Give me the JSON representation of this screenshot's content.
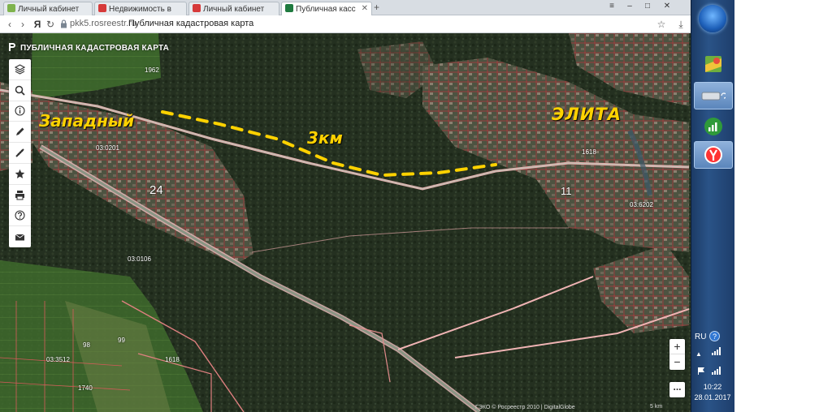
{
  "browser": {
    "tabs": [
      {
        "label": "Личный кабинет",
        "favicon_color": "#7fb34d"
      },
      {
        "label": "Недвижимость в",
        "favicon_color": "#d63a3a"
      },
      {
        "label": "Личный кабинет",
        "favicon_color": "#d63a3a"
      },
      {
        "label": "Публичная касс",
        "favicon_color": "#1f7a3f"
      }
    ],
    "url": "pkk5.rosreestr.ru",
    "page_title": "Публичная кадастровая карта"
  },
  "map": {
    "app_title": "ПУБЛИЧНАЯ КАДАСТРОВАЯ КАРТА",
    "toolbar_icons": [
      "layers-icon",
      "search-icon",
      "info-icon",
      "pencil-icon",
      "measure-icon",
      "star-icon",
      "print-icon",
      "help-icon",
      "mail-icon"
    ],
    "annotations": {
      "west_settlement": "Западный",
      "elita_settlement": "ЭЛИТА",
      "distance": "3км"
    },
    "plot_numbers": {
      "n24": "24",
      "n11": "11",
      "c1": "03:0201",
      "c2": "03:0106",
      "c3": "03:6202",
      "c4": "03:3512",
      "c5": "1618",
      "c6": "1618",
      "c7": "1962",
      "c8": "99",
      "c9": "98",
      "c10": "1740"
    },
    "zoom_in": "+",
    "zoom_out": "−",
    "more": "...",
    "attribution": "ГЭКО © Росреестр 2010 | DigitalGlobe",
    "scale_label": "5 km",
    "colors": {
      "annotation": "#ffd200",
      "parcel_border": "#e0303a",
      "road": "#f0b4b4"
    }
  },
  "taskbar": {
    "language": "RU",
    "help": "?",
    "time": "10:22",
    "date": "28.01.2017"
  }
}
